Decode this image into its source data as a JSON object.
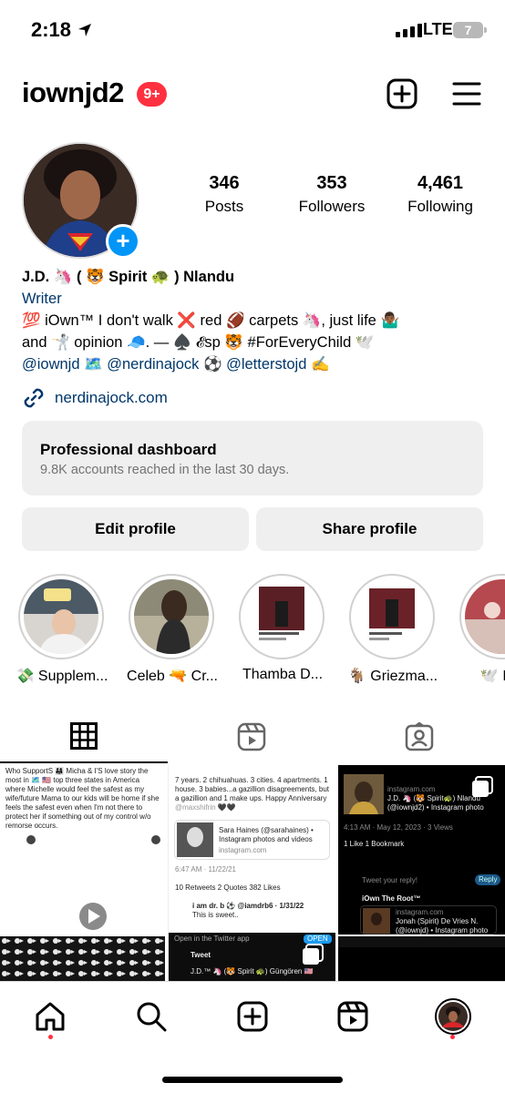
{
  "status_bar": {
    "time": "2:18",
    "network": "LTE",
    "battery": "7"
  },
  "header": {
    "username": "iownjd2",
    "notification_badge": "9+"
  },
  "profile": {
    "stats": [
      {
        "value": "346",
        "label": "Posts"
      },
      {
        "value": "353",
        "label": "Followers"
      },
      {
        "value": "4,461",
        "label": "Following"
      }
    ],
    "name": "J.D. 🦄 ( 🐯 Spirit 🐢 ) Nlandu",
    "category": "Writer",
    "bio_line1": "💯 iOwn™ I don't walk ❌ red 🏈 carpets 🦄, just life 🤷🏾‍♂️",
    "bio_line2": "and 🤺 opinion 🧢. — ♠️ 𝓔sp 🐯 #ForEveryChild 🕊️",
    "bio_mentions": "@iownjd 🗺️ @nerdinajock ⚽ @letterstojd ✍️",
    "link": "nerdinajock.com"
  },
  "dashboard": {
    "title": "Professional dashboard",
    "subtitle": "9.8K accounts reached in the last 30 days."
  },
  "buttons": {
    "edit": "Edit profile",
    "share": "Share profile"
  },
  "highlights": [
    {
      "label": "💸 Supplem..."
    },
    {
      "label": "Celeb 🔫 Cr..."
    },
    {
      "label": "Thamba D..."
    },
    {
      "label": "🐐 Griezma..."
    },
    {
      "label": "🕊️ Indi"
    }
  ],
  "posts": {
    "p1_text": "Who SupportS 👨‍👩‍👧 Micha & I'S love story the most in 🗺️ 🇺🇸 top three states in America where Michelle would feel the safest as my wife/future Mama to our kids will be home if she feels the safest even when I'm not there to protect her if something out of my control w/o remorse occurs.",
    "p2_text": "7 years. 2 chihuahuas. 3 cities. 4 apartments. 1 house. 3 babies...a gazillion disagreements, but a gazillion and 1 make ups. Happy Anniversary",
    "p2_handle": "@maxshifrin 🖤🖤",
    "p2_card_title": "Sara Haines (@sarahaines) • Instagram photos and videos",
    "p2_card_domain": "instagram.com",
    "p2_time": "6:47 AM · 11/22/21",
    "p2_stats": "10 Retweets  2 Quotes  382 Likes",
    "p2_reply_name": "i am dr. b ⚽ @iamdrb6 · 1/31/22",
    "p2_reply_text": "This is sweet..",
    "p2_open": "Open in the Twitter app",
    "p2_open_btn": "OPEN",
    "p2_tweet": "Tweet",
    "p2_tweet_author": "J.D.™ 🦄 (🐯 Spirit 🐢) Güngören 🇺🇸",
    "p3_domain": "instagram.com",
    "p3_title": "J.D. 🦄 (🐯 Spirit🐢) Nlandu (@iownjd2) • Instagram photo",
    "p3_time": "4:13 AM · May 12, 2023 · 3 Views",
    "p3_likes": "1 Like  1 Bookmark",
    "p3_reply": "Tweet your reply!",
    "p3_reply_btn": "Reply",
    "p3_author": "iOwn The Root™",
    "p3_card_domain": "instagram.com",
    "p3_card_title": "Jonah (Spirit) De Vries N. (@iownjd) • Instagram photo"
  },
  "colors": {
    "accent": "#0095f6",
    "badge": "#ff3040",
    "link": "#00376b",
    "muted": "#737373",
    "button_bg": "#efefef"
  },
  "icons": [
    "location-arrow-icon",
    "create-icon",
    "menu-icon",
    "link-icon",
    "grid-icon",
    "reels-icon",
    "tagged-icon",
    "home-icon",
    "search-icon",
    "add-post-icon",
    "reels-nav-icon",
    "profile-avatar-icon"
  ]
}
